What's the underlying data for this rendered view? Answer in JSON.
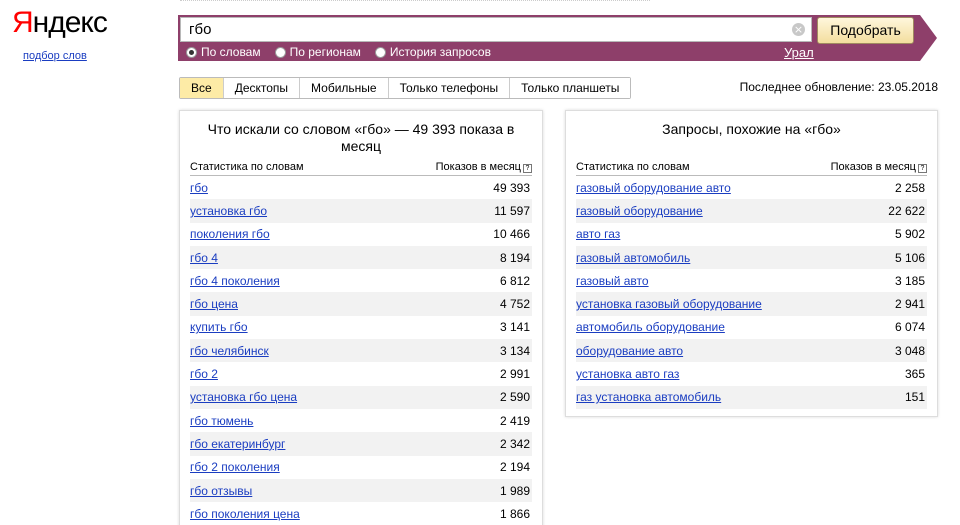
{
  "logo": {
    "first": "Я",
    "rest": "ндекс",
    "subtitle": "подбор слов"
  },
  "search": {
    "value": "гбо",
    "clear": "×",
    "button": "Подобрать",
    "region": "Урал"
  },
  "modes": [
    {
      "label": "По словам",
      "checked": true
    },
    {
      "label": "По регионам",
      "checked": false
    },
    {
      "label": "История запросов",
      "checked": false
    }
  ],
  "tabs": [
    {
      "label": "Все",
      "active": true
    },
    {
      "label": "Десктопы",
      "active": false
    },
    {
      "label": "Мобильные",
      "active": false
    },
    {
      "label": "Только телефоны",
      "active": false
    },
    {
      "label": "Только планшеты",
      "active": false
    }
  ],
  "updated": "Последнее обновление: 23.05.2018",
  "left": {
    "title": "Что искали со словом «гбо» — 49 393 показа в месяц",
    "col_term": "Статистика по словам",
    "col_count": "Показов в месяц",
    "help": "?",
    "rows": [
      {
        "term": "гбо",
        "count": "49 393"
      },
      {
        "term": "установка гбо",
        "count": "11 597"
      },
      {
        "term": "поколения гбо",
        "count": "10 466"
      },
      {
        "term": "гбо 4",
        "count": "8 194"
      },
      {
        "term": "гбо 4 поколения",
        "count": "6 812"
      },
      {
        "term": "гбо цена",
        "count": "4 752"
      },
      {
        "term": "купить гбо",
        "count": "3 141"
      },
      {
        "term": "гбо челябинск",
        "count": "3 134"
      },
      {
        "term": "гбо 2",
        "count": "2 991"
      },
      {
        "term": "установка гбо цена",
        "count": "2 590"
      },
      {
        "term": "гбо тюмень",
        "count": "2 419"
      },
      {
        "term": "гбо екатеринбург",
        "count": "2 342"
      },
      {
        "term": "гбо 2 поколения",
        "count": "2 194"
      },
      {
        "term": "гбо отзывы",
        "count": "1 989"
      },
      {
        "term": "гбо поколения цена",
        "count": "1 866"
      }
    ]
  },
  "right": {
    "title": "Запросы, похожие на «гбо»",
    "col_term": "Статистика по словам",
    "col_count": "Показов в месяц",
    "help": "?",
    "rows": [
      {
        "term": "газовый оборудование авто",
        "count": "2 258"
      },
      {
        "term": "газовый оборудование",
        "count": "22 622"
      },
      {
        "term": "авто газ",
        "count": "5 902"
      },
      {
        "term": "газовый автомобиль",
        "count": "5 106"
      },
      {
        "term": "газовый авто",
        "count": "3 185"
      },
      {
        "term": "установка газовый оборудование",
        "count": "2 941"
      },
      {
        "term": "автомобиль оборудование",
        "count": "6 074"
      },
      {
        "term": "оборудование авто",
        "count": "3 048"
      },
      {
        "term": "установка авто газ",
        "count": "365"
      },
      {
        "term": "газ установка автомобиль",
        "count": "151"
      }
    ]
  }
}
